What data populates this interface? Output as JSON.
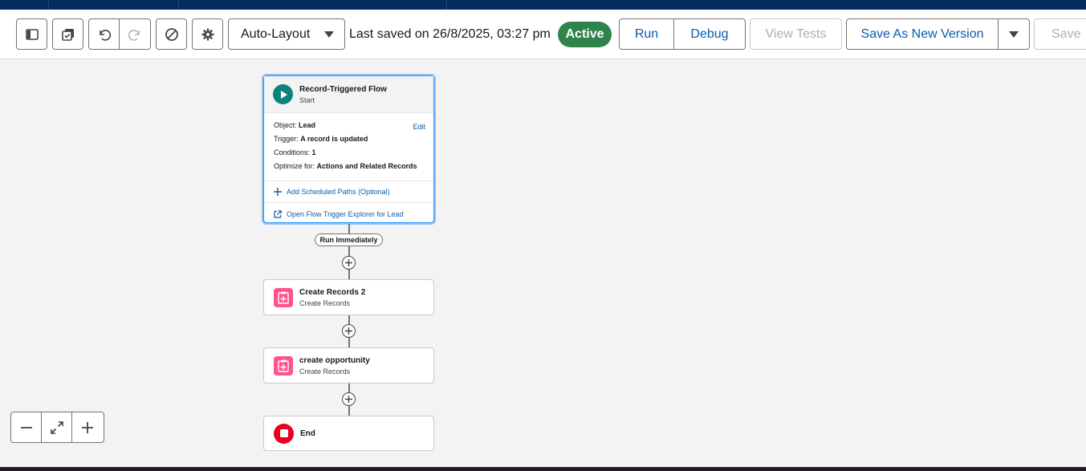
{
  "toolbar": {
    "layout_select": "Auto-Layout",
    "last_saved": "Last saved on 26/8/2025, 03:27 pm",
    "status_badge": "Active",
    "run_label": "Run",
    "debug_label": "Debug",
    "view_tests_label": "View Tests",
    "save_as_new_label": "Save As New Version",
    "save_label": "Save"
  },
  "start_node": {
    "title": "Record-Triggered Flow",
    "subtitle": "Start",
    "object_label": "Object:",
    "object_value": "Lead",
    "edit": "Edit",
    "trigger_label": "Trigger:",
    "trigger_value": "A record is updated",
    "conditions_label": "Conditions:",
    "conditions_value": "1",
    "optimize_label": "Optimize for:",
    "optimize_value": "Actions and Related Records",
    "scheduled_paths": "Add Scheduled Paths (Optional)",
    "trigger_explorer": "Open Flow Trigger Explorer for Lead"
  },
  "path_label": "Run Immediately",
  "nodes": [
    {
      "title": "Create Records 2",
      "subtitle": "Create Records"
    },
    {
      "title": "create opportunity",
      "subtitle": "Create Records"
    }
  ],
  "end_node": {
    "title": "End"
  },
  "colors": {
    "brand_nav": "#032d60",
    "active_badge": "#2e844a",
    "link_blue": "#0b5cab",
    "start_icon": "#0b827c",
    "create_icon": "#ff538a",
    "end_icon": "#ea001e"
  }
}
